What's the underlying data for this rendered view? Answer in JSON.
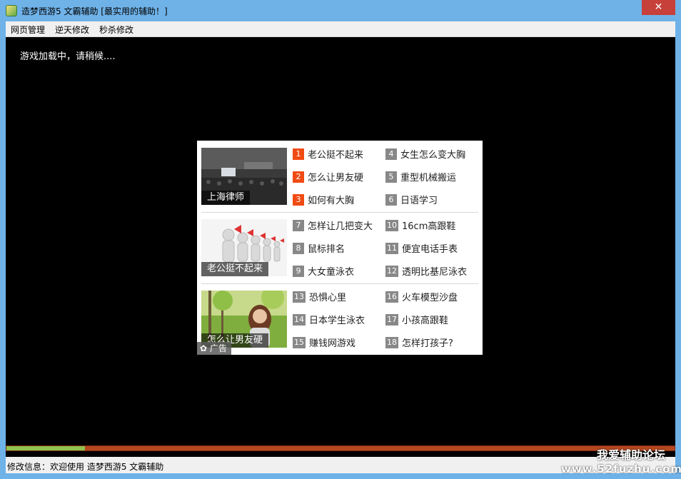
{
  "window": {
    "title": "造梦西游5 文霸辅助 [最实用的辅助！]",
    "close_glyph": "✕"
  },
  "menu": {
    "items": [
      "网页管理",
      "逆天修改",
      "秒杀修改"
    ]
  },
  "content": {
    "loading_text": "游戏加载中，请稍候...."
  },
  "ad": {
    "sections": [
      {
        "caption": "上海律师",
        "links": [
          {
            "num": "1",
            "label": "老公挺不起来",
            "hot": true
          },
          {
            "num": "2",
            "label": "怎么让男友硬",
            "hot": true
          },
          {
            "num": "3",
            "label": "如何有大胸",
            "hot": true
          },
          {
            "num": "4",
            "label": "女生怎么变大胸",
            "hot": false
          },
          {
            "num": "5",
            "label": "重型机械搬运",
            "hot": false
          },
          {
            "num": "6",
            "label": "日语学习",
            "hot": false
          }
        ]
      },
      {
        "caption": "老公挺不起来",
        "links": [
          {
            "num": "7",
            "label": "怎样让几把变大",
            "hot": false
          },
          {
            "num": "8",
            "label": "鼠标排名",
            "hot": false
          },
          {
            "num": "9",
            "label": "大女童泳衣",
            "hot": false
          },
          {
            "num": "10",
            "label": "16cm高跟鞋",
            "hot": false
          },
          {
            "num": "11",
            "label": "便宜电话手表",
            "hot": false
          },
          {
            "num": "12",
            "label": "透明比基尼泳衣",
            "hot": false
          }
        ]
      },
      {
        "caption": "怎么让男友硬",
        "links": [
          {
            "num": "13",
            "label": "恐惧心里",
            "hot": false
          },
          {
            "num": "14",
            "label": "日本学生泳衣",
            "hot": false
          },
          {
            "num": "15",
            "label": "赚钱网游戏",
            "hot": false
          },
          {
            "num": "16",
            "label": "火车模型沙盘",
            "hot": false
          },
          {
            "num": "17",
            "label": "小孩高跟鞋",
            "hot": false
          },
          {
            "num": "18",
            "label": "怎样打孩子?",
            "hot": false
          }
        ]
      }
    ],
    "ad_tag": "广告",
    "hot_color": "#f04b14",
    "normal_color": "#888888"
  },
  "progress": {
    "fraction": 0.118
  },
  "status": {
    "text": "修改信息：欢迎使用 造梦西游5 文霸辅助"
  },
  "watermark": {
    "line1": "我爱辅助论坛",
    "line2": "www.52fuzhu.com"
  },
  "colors": {
    "titlebar": "#6fb2e8",
    "close": "#c7403a",
    "progress_track": "#b5471f",
    "progress_fill": "#8fc24e"
  }
}
